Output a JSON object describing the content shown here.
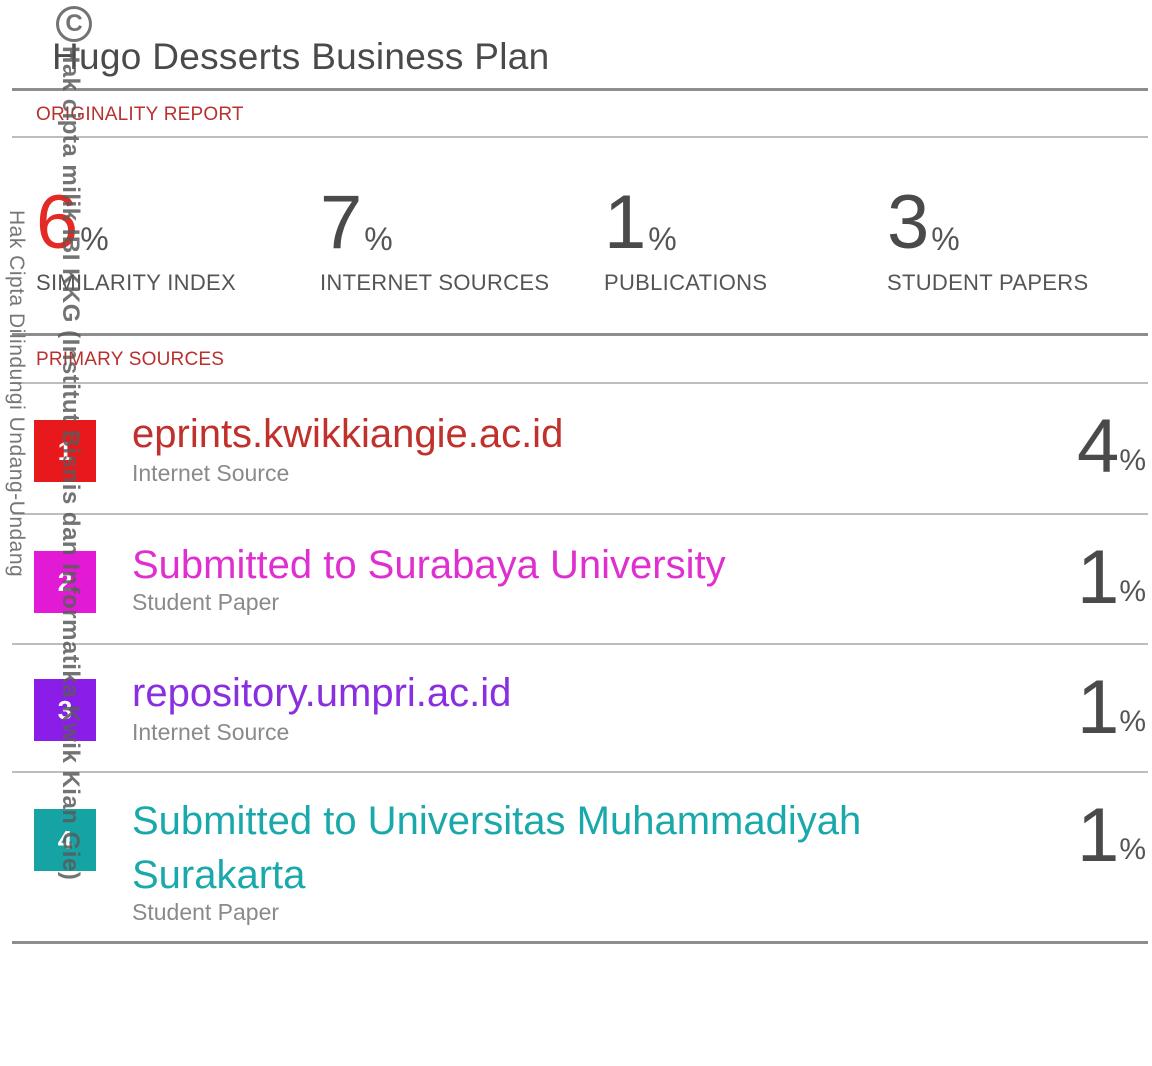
{
  "document": {
    "title": "Hugo Desserts Business Plan",
    "originality_label": "ORIGINALITY REPORT",
    "primary_sources_label": "PRIMARY SOURCES"
  },
  "stats": [
    {
      "value": "6",
      "unit": "%",
      "label": "SIMILARITY INDEX",
      "color": "#e32a24"
    },
    {
      "value": "7",
      "unit": "%",
      "label": "INTERNET SOURCES"
    },
    {
      "value": "1",
      "unit": "%",
      "label": "PUBLICATIONS"
    },
    {
      "value": "3",
      "unit": "%",
      "label": "STUDENT PAPERS"
    }
  ],
  "sources": [
    {
      "rank": "1",
      "name": "eprints.kwikkiangie.ac.id",
      "type": "Internet Source",
      "percent": "4",
      "unit": "%",
      "color": "#e8191c",
      "text_color": "#c0302c"
    },
    {
      "rank": "2",
      "name": "Submitted to Surabaya University",
      "type": "Student Paper",
      "percent": "1",
      "unit": "%",
      "color": "#e21ad6",
      "text_color": "#e02fd0"
    },
    {
      "rank": "3",
      "name": "repository.umpri.ac.id",
      "type": "Internet Source",
      "percent": "1",
      "unit": "%",
      "color": "#8a1ee8",
      "text_color": "#8a2fe0"
    },
    {
      "rank": "4",
      "name_line1": "Submitted to Universitas Muhammadiyah",
      "name_line2": "Surakarta",
      "type": "Student Paper",
      "percent": "1",
      "unit": "%",
      "color": "#16a3a3",
      "text_color": "#1aa9ab"
    }
  ],
  "watermark": {
    "copyright_symbol": "C",
    "bold_text": "Hak cipta milik IBI KKG (Institut Bisnis dan Informatika Kwik Kian Gie)",
    "side_text": "Hak Cipta Dilindungi Undang-Undang"
  }
}
